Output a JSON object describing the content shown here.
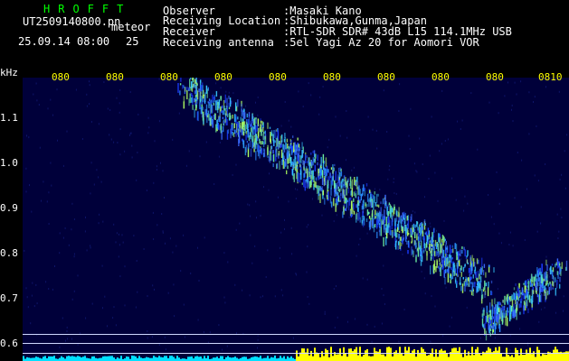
{
  "title": "HROFFT",
  "file_name": "UT2509140800.pn",
  "mode_label": "meteor",
  "date_time": "25.09.14 08:00",
  "count": "25",
  "info": {
    "observer_label": "Observer",
    "observer_value": ":Masaki Kano",
    "location_label": "Receiving Location",
    "location_value": ":Shibukawa,Gunma,Japan",
    "receiver_label": "Receiver",
    "receiver_value": ":RTL-SDR SDR# 43dB L15 114.1MHz USB",
    "antenna_label": "Receiving antenna",
    "antenna_value": ":5el Yagi Az 20 for Aomori VOR"
  },
  "y_unit": "kHz",
  "y_ticks": [
    "1.1",
    "1.0",
    "0.9",
    "0.8",
    "0.7",
    "0.6"
  ],
  "x_ticks": [
    "080",
    "080",
    "080",
    "080",
    "080",
    "080",
    "080",
    "080",
    "080",
    "0810"
  ],
  "colors": {
    "title": "#00ff00",
    "text": "#ffffff",
    "x_ticks": "#ffff00",
    "background": "#00003a"
  }
}
